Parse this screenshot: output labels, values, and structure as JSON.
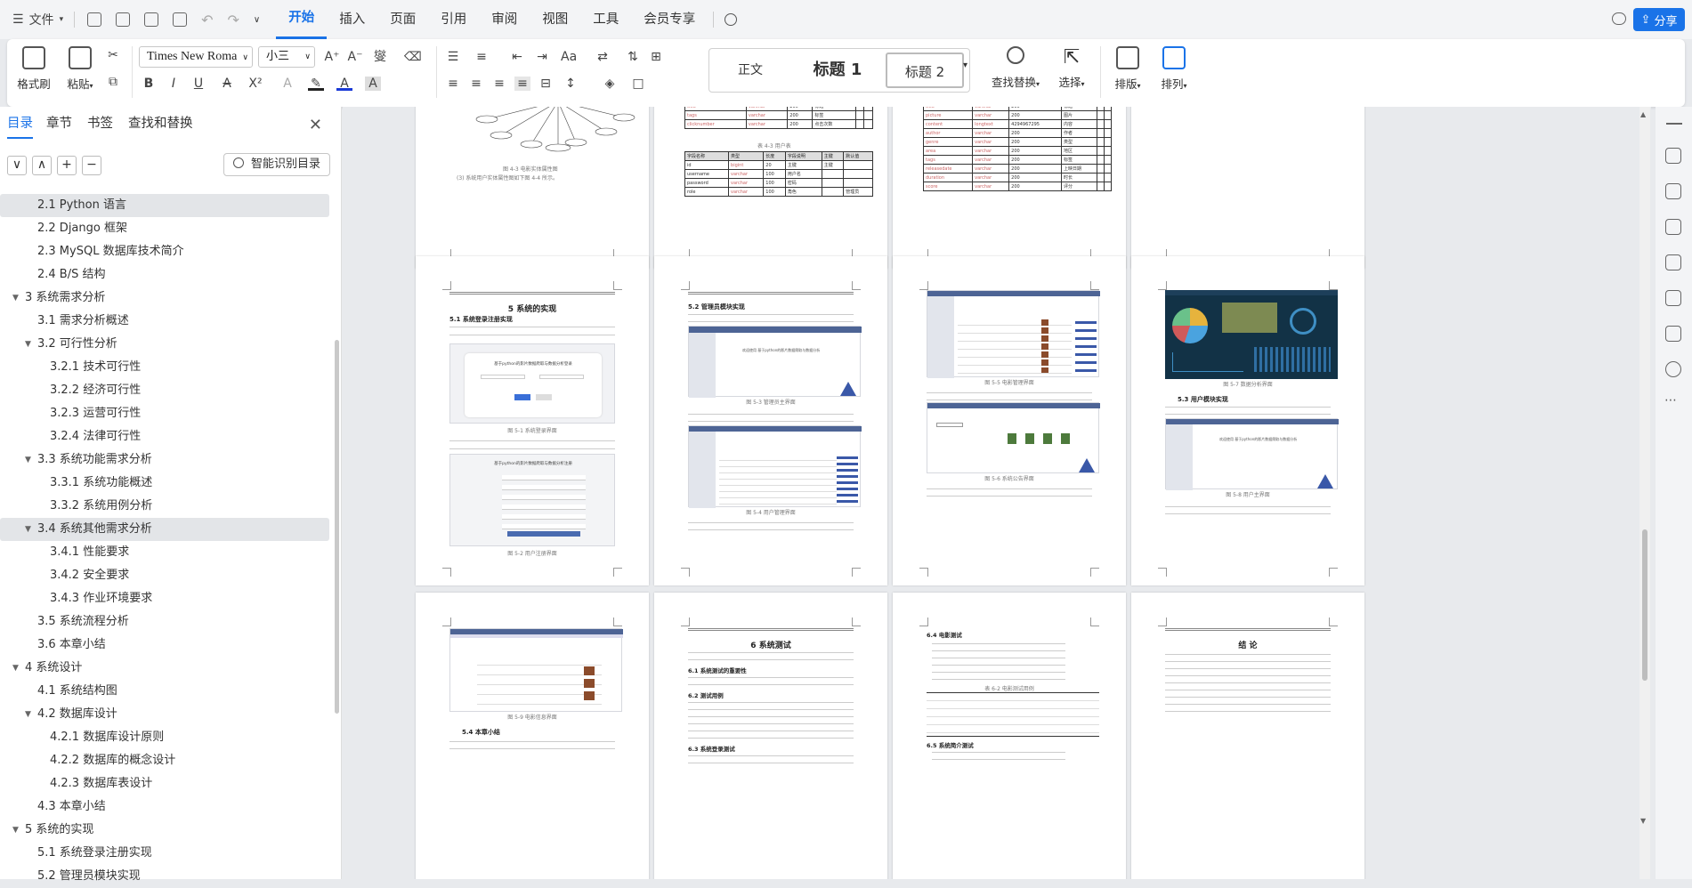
{
  "titlebar": {
    "file_label": "文件",
    "tabs": [
      "开始",
      "插入",
      "页面",
      "引用",
      "审阅",
      "视图",
      "工具",
      "会员专享"
    ],
    "active_tab": "开始",
    "share_label": "分享",
    "accent_color": "#1a73e8"
  },
  "ribbon": {
    "format_painter": "格式刷",
    "paste": "粘贴",
    "font_name": "Times New Roma",
    "font_size": "小三",
    "styles": [
      "正文",
      "标题 1",
      "标题 2"
    ],
    "find_replace": "查找替换",
    "select": "选择",
    "layout": "排版",
    "arrange": "排列"
  },
  "sidebar": {
    "tabs": [
      "目录",
      "章节",
      "书签",
      "查找和替换"
    ],
    "active_tab": "目录",
    "controls": [
      "∨",
      "∧",
      "+",
      "−"
    ],
    "smart_toc": "智能识别目录",
    "toc": [
      {
        "label": "2.1 Python 语言",
        "level": 2,
        "selected": true
      },
      {
        "label": "2.2 Django 框架",
        "level": 2
      },
      {
        "label": "2.3 MySQL 数据库技术简介",
        "level": 2
      },
      {
        "label": "2.4 B/S 结构",
        "level": 2
      },
      {
        "label": "3 系统需求分析",
        "level": 1,
        "expanded": true
      },
      {
        "label": "3.1 需求分析概述",
        "level": 2
      },
      {
        "label": "3.2 可行性分析",
        "level": 2,
        "expanded": true
      },
      {
        "label": "3.2.1 技术可行性",
        "level": 3
      },
      {
        "label": "3.2.2 经济可行性",
        "level": 3
      },
      {
        "label": "3.2.3 运营可行性",
        "level": 3
      },
      {
        "label": "3.2.4 法律可行性",
        "level": 3
      },
      {
        "label": "3.3 系统功能需求分析",
        "level": 2,
        "expanded": true
      },
      {
        "label": "3.3.1 系统功能概述",
        "level": 3
      },
      {
        "label": "3.3.2 系统用例分析",
        "level": 3
      },
      {
        "label": "3.4 系统其他需求分析",
        "level": 2,
        "expanded": true,
        "selected": true
      },
      {
        "label": "3.4.1 性能要求",
        "level": 3
      },
      {
        "label": "3.4.2 安全要求",
        "level": 3
      },
      {
        "label": "3.4.3 作业环境要求",
        "level": 3
      },
      {
        "label": "3.5 系统流程分析",
        "level": 2
      },
      {
        "label": "3.6 本章小结",
        "level": 2
      },
      {
        "label": "4 系统设计",
        "level": 1,
        "expanded": true
      },
      {
        "label": "4.1 系统结构图",
        "level": 2
      },
      {
        "label": "4.2 数据库设计",
        "level": 2,
        "expanded": true
      },
      {
        "label": "4.2.1 数据库设计原则",
        "level": 3
      },
      {
        "label": "4.2.2 数据库的概念设计",
        "level": 3
      },
      {
        "label": "4.2.3 数据库表设计",
        "level": 3
      },
      {
        "label": "4.3 本章小结",
        "level": 2
      },
      {
        "label": "5 系统的实现",
        "level": 1,
        "expanded": true
      },
      {
        "label": "5.1 系统登录注册实现",
        "level": 2
      },
      {
        "label": "5.2 管理员模块实现",
        "level": 2
      }
    ]
  },
  "pages": {
    "p1_caption": "图 4-3 电影实体属性图",
    "p1_text": "(3) 系统用户实体属性图如下图 4-4 所示。",
    "p2_caption": "表 4-3 用户表",
    "p2_headers": [
      "字段名称",
      "类型",
      "长度",
      "字段说明",
      "主键",
      "默认值"
    ],
    "p2_rows": [
      [
        "id",
        "bigint",
        "20",
        "主键",
        "主键",
        ""
      ],
      [
        "username",
        "varchar",
        "100",
        "用户名",
        "",
        ""
      ],
      [
        "password",
        "varchar",
        "100",
        "密码",
        "",
        ""
      ],
      [
        "role",
        "varchar",
        "100",
        "角色",
        "",
        "管理员"
      ]
    ],
    "p5_heading": "5 系统的实现",
    "p5_sub": "5.1 系统登录注册实现",
    "p5_shot_title": "基于python的影片数据爬取与数据分析登录",
    "p5_cap1": "图 5-1 系统登录界面",
    "p5_cap2": "图 5-2 用户注册界面",
    "p5_shot2_title": "基于python的影片数据爬取与数据分析注册",
    "p6_sub": "5.2 管理员模块实现",
    "p6_shot_text": "欢迎使用 基于python的影片数据爬取与数据分析",
    "p6_cap1": "图 5-3 管理员主界面",
    "p6_cap2": "图 5-4 用户管理界面",
    "p7_cap1": "图 5-5 电影管理界面",
    "p7_cap2": "图 5-6 系统公告界面",
    "p8_cap1": "图 5-7 数据分析界面",
    "p8_sub": "5.3 用户模块实现",
    "p8_cap2": "图 5-8 用户主界面",
    "p9_cap": "图 5-9 电影信息界面",
    "p9_sub": "5.4 本章小结",
    "p10_heading": "6 系统测试",
    "p10_s1": "6.1 系统测试的重要性",
    "p10_s2": "6.2 测试用例",
    "p10_s3": "6.3 系统登录测试",
    "p11_s1": "6.4 电影测试",
    "p11_table_cap": "表 6-2 电影测试用例",
    "p11_s2": "6.5 系统简介测试",
    "p12_heading": "结 论"
  }
}
